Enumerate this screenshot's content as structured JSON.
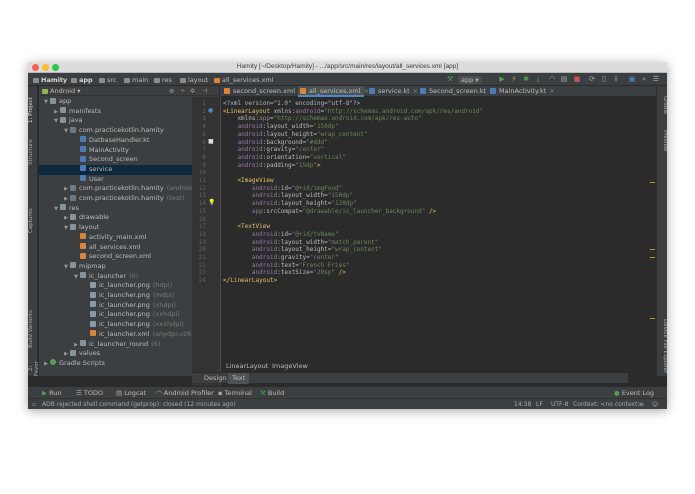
{
  "window": {
    "title": "Hamity [~/Desktop/Hamity] - .../app/src/main/res/layout/all_services.xml [app]"
  },
  "navbar": {
    "crumbs": [
      "Hamity",
      "app",
      "src",
      "main",
      "res",
      "layout",
      "all_services.xml"
    ],
    "run_config": "app"
  },
  "project_panel": {
    "view_label": "Android",
    "tree": [
      {
        "label": "app",
        "extra": "",
        "icon": "folder",
        "depth": 0,
        "arrow": "▼"
      },
      {
        "label": "manifests",
        "extra": "",
        "icon": "folder",
        "depth": 1,
        "arrow": "▶"
      },
      {
        "label": "java",
        "extra": "",
        "icon": "folder",
        "depth": 1,
        "arrow": "▼"
      },
      {
        "label": "com.practicekotlin.hamity",
        "extra": "",
        "icon": "pkg",
        "depth": 2,
        "arrow": "▼"
      },
      {
        "label": "DatbaseHandler.kt",
        "extra": "",
        "icon": "kt",
        "depth": 3,
        "arrow": ""
      },
      {
        "label": "MainActivity",
        "extra": "",
        "icon": "kt",
        "depth": 3,
        "arrow": ""
      },
      {
        "label": "Second_screen",
        "extra": "",
        "icon": "kt",
        "depth": 3,
        "arrow": ""
      },
      {
        "label": "service",
        "extra": "",
        "icon": "kt",
        "depth": 3,
        "arrow": "",
        "selected": true
      },
      {
        "label": "User",
        "extra": "",
        "icon": "kt",
        "depth": 3,
        "arrow": ""
      },
      {
        "label": "com.practicekotlin.hamity",
        "extra": "(androidT",
        "icon": "pkg",
        "depth": 2,
        "arrow": "▶"
      },
      {
        "label": "com.practicekotlin.hamity",
        "extra": "(test)",
        "icon": "pkg",
        "depth": 2,
        "arrow": "▶"
      },
      {
        "label": "res",
        "extra": "",
        "icon": "folder",
        "depth": 1,
        "arrow": "▼"
      },
      {
        "label": "drawable",
        "extra": "",
        "icon": "folder",
        "depth": 2,
        "arrow": "▶"
      },
      {
        "label": "layout",
        "extra": "",
        "icon": "folder",
        "depth": 2,
        "arrow": "▼"
      },
      {
        "label": "activity_main.xml",
        "extra": "",
        "icon": "xml",
        "depth": 3,
        "arrow": ""
      },
      {
        "label": "all_services.xml",
        "extra": "",
        "icon": "xml",
        "depth": 3,
        "arrow": ""
      },
      {
        "label": "second_screen.xml",
        "extra": "",
        "icon": "xml",
        "depth": 3,
        "arrow": ""
      },
      {
        "label": "mipmap",
        "extra": "",
        "icon": "folder",
        "depth": 2,
        "arrow": "▼"
      },
      {
        "label": "ic_launcher",
        "extra": "(6)",
        "icon": "folder",
        "depth": 3,
        "arrow": "▼"
      },
      {
        "label": "ic_launcher.png",
        "extra": "(hdpi)",
        "icon": "res",
        "depth": 4,
        "arrow": ""
      },
      {
        "label": "ic_launcher.png",
        "extra": "(mdpi)",
        "icon": "res",
        "depth": 4,
        "arrow": ""
      },
      {
        "label": "ic_launcher.png",
        "extra": "(xhdpi)",
        "icon": "res",
        "depth": 4,
        "arrow": ""
      },
      {
        "label": "ic_launcher.png",
        "extra": "(xxhdpi)",
        "icon": "res",
        "depth": 4,
        "arrow": ""
      },
      {
        "label": "ic_launcher.png",
        "extra": "(xxxhdpi)",
        "icon": "res",
        "depth": 4,
        "arrow": ""
      },
      {
        "label": "ic_launcher.xml",
        "extra": "(anydpi-v26)",
        "icon": "xml",
        "depth": 4,
        "arrow": ""
      },
      {
        "label": "ic_launcher_round",
        "extra": "(6)",
        "icon": "folder",
        "depth": 3,
        "arrow": "▶"
      },
      {
        "label": "values",
        "extra": "",
        "icon": "folder",
        "depth": 2,
        "arrow": "▶"
      },
      {
        "label": "Gradle Scripts",
        "extra": "",
        "icon": "grad",
        "depth": 0,
        "arrow": "▶"
      }
    ]
  },
  "left_tool_tabs": [
    "1: Project",
    "Structure",
    "Captures",
    "Build Variants",
    "2: Favorites"
  ],
  "right_tool_tabs": [
    "Gradle",
    "Preview",
    "Device File Explorer"
  ],
  "editor_tabs": [
    {
      "label": "second_screen.xml",
      "active": false
    },
    {
      "label": "all_services.xml",
      "active": true
    },
    {
      "label": "service.kt",
      "active": false
    },
    {
      "label": "Second_screen.kt",
      "active": false
    },
    {
      "label": "MainActivity.kt",
      "active": false
    }
  ],
  "code": [
    [
      [
        "<?xml version=\"1.0\" encoding=\"utf-8\"?>",
        "plain"
      ]
    ],
    [
      [
        "<LinearLayout ",
        "tag"
      ],
      [
        "xmlns:",
        "attr"
      ],
      [
        "android",
        "ns"
      ],
      [
        "=",
        "attr"
      ],
      [
        "\"http://schemas.android.com/apk/res/android\"",
        "val"
      ]
    ],
    [
      [
        "    xmlns:",
        "attr"
      ],
      [
        "app",
        "ns"
      ],
      [
        "=",
        "attr"
      ],
      [
        "\"http://schemas.android.com/apk/res-auto\"",
        "val"
      ]
    ],
    [
      [
        "    ",
        "attr"
      ],
      [
        "android",
        "ns"
      ],
      [
        ":layout_width=",
        "attr"
      ],
      [
        "\"150dp\"",
        "val"
      ]
    ],
    [
      [
        "    ",
        "attr"
      ],
      [
        "android",
        "ns"
      ],
      [
        ":layout_height=",
        "attr"
      ],
      [
        "\"wrap_content\"",
        "val"
      ]
    ],
    [
      [
        "    ",
        "attr"
      ],
      [
        "android",
        "ns"
      ],
      [
        ":background=",
        "attr"
      ],
      [
        "\"#ddd\"",
        "val"
      ]
    ],
    [
      [
        "    ",
        "attr"
      ],
      [
        "android",
        "ns"
      ],
      [
        ":gravity=",
        "attr"
      ],
      [
        "\"center\"",
        "val"
      ]
    ],
    [
      [
        "    ",
        "attr"
      ],
      [
        "android",
        "ns"
      ],
      [
        ":orientation=",
        "attr"
      ],
      [
        "\"vertical\"",
        "val"
      ]
    ],
    [
      [
        "    ",
        "attr"
      ],
      [
        "android",
        "ns"
      ],
      [
        ":padding=",
        "attr"
      ],
      [
        "\"15dp\"",
        "val"
      ],
      [
        ">",
        "tag"
      ]
    ],
    [],
    [
      [
        "    <ImageView",
        "tag"
      ]
    ],
    [
      [
        "        ",
        "attr"
      ],
      [
        "android",
        "ns"
      ],
      [
        ":id=",
        "attr"
      ],
      [
        "\"@+id/imgFood\"",
        "val"
      ]
    ],
    [
      [
        "        ",
        "attr"
      ],
      [
        "android",
        "ns"
      ],
      [
        ":layout_width=",
        "attr"
      ],
      [
        "\"150dp\"",
        "val"
      ]
    ],
    [
      [
        "        ",
        "attr"
      ],
      [
        "android",
        "ns"
      ],
      [
        ":layout_height=",
        "attr"
      ],
      [
        "\"120dp\"",
        "val"
      ]
    ],
    [
      [
        "        ",
        "attr"
      ],
      [
        "app",
        "ns"
      ],
      [
        ":srcCompat=",
        "attr"
      ],
      [
        "\"@drawable/ic_launcher_background\"",
        "val"
      ],
      [
        " />",
        "tag"
      ]
    ],
    [],
    [
      [
        "    <TextView",
        "tag"
      ]
    ],
    [
      [
        "        ",
        "attr"
      ],
      [
        "android",
        "ns"
      ],
      [
        ":id=",
        "attr"
      ],
      [
        "\"@+id/tvName\"",
        "val"
      ]
    ],
    [
      [
        "        ",
        "attr"
      ],
      [
        "android",
        "ns"
      ],
      [
        ":layout_width=",
        "attr"
      ],
      [
        "\"match_parent\"",
        "val"
      ]
    ],
    [
      [
        "        ",
        "attr"
      ],
      [
        "android",
        "ns"
      ],
      [
        ":layout_height=",
        "attr"
      ],
      [
        "\"wrap_content\"",
        "val"
      ]
    ],
    [
      [
        "        ",
        "attr"
      ],
      [
        "android",
        "ns"
      ],
      [
        ":gravity=",
        "attr"
      ],
      [
        "\"center\"",
        "val"
      ]
    ],
    [
      [
        "        ",
        "attr"
      ],
      [
        "android",
        "ns"
      ],
      [
        ":text=",
        "attr"
      ],
      [
        "\"French Fries\"",
        "val"
      ]
    ],
    [
      [
        "        ",
        "attr"
      ],
      [
        "android",
        "ns"
      ],
      [
        ":textSize=",
        "attr"
      ],
      [
        "\"20sp\"",
        "val"
      ],
      [
        " />",
        "tag"
      ]
    ],
    [
      [
        "</LinearLayout>",
        "tag"
      ]
    ]
  ],
  "breadcrumb": [
    "LinearLayout",
    "ImageView"
  ],
  "design_tabs": [
    {
      "label": "Design",
      "active": false
    },
    {
      "label": "Text",
      "active": true
    }
  ],
  "tool_windows": [
    "Run",
    "TODO",
    "Logcat",
    "Android Profiler",
    "Terminal",
    "Build",
    "Event Log"
  ],
  "status": {
    "message": "ADB rejected shell command (getprop): closed (12 minutes ago)",
    "position": "14:38",
    "line_sep": "LF",
    "encoding": "UTF-8",
    "context": "Context: <no context>"
  },
  "colors": {
    "tl_close": "#fd5f57",
    "tl_min": "#febc2e",
    "tl_max": "#28c840",
    "accent": "#4a88c7",
    "run_green": "#4fa04c"
  }
}
